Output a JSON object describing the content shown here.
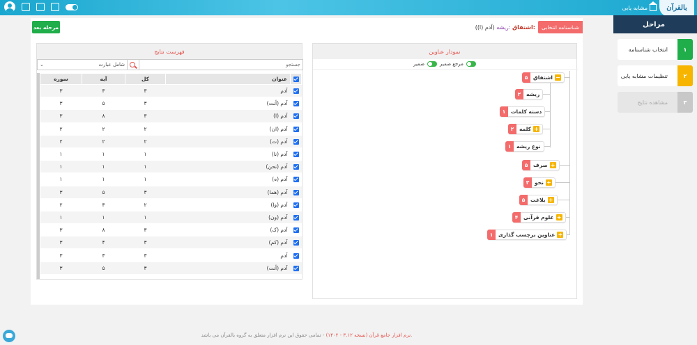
{
  "topbar": {
    "crumb": "مشابه یابی"
  },
  "steps": {
    "title": "مراحل",
    "items": [
      {
        "num": "۱",
        "label": "انتخاب شناسنامه"
      },
      {
        "num": "۲",
        "label": "تنظیمات مشابه یابی"
      },
      {
        "num": "۳",
        "label": "مشاهده نتایج"
      }
    ]
  },
  "main": {
    "next_button": "مرحله بعد",
    "chip_label": "شناسنامه انتخابی",
    "chip_key": "اشتقاق:",
    "chip_key2": "ریشه:",
    "chip_value": "(آدم (ا))"
  },
  "tree": {
    "title": "نمودار عناوین",
    "opt1": "مرجع ضمیر",
    "opt2": "ضمیر",
    "nodes": [
      {
        "label": "اشتقاق",
        "count": "۵"
      },
      {
        "label": "ریشه",
        "count": "۲"
      },
      {
        "label": "دسته کلمات",
        "count": "۱"
      },
      {
        "label": "کلمه",
        "count": "۲"
      },
      {
        "label": "نوع ریشه",
        "count": "۱"
      },
      {
        "label": "صرف",
        "count": "۵"
      },
      {
        "label": "نحو",
        "count": "۳"
      },
      {
        "label": "بلاغت",
        "count": "۵"
      },
      {
        "label": "علوم قرآنی",
        "count": "۴"
      },
      {
        "label": "عناوین برچسب گذاری",
        "count": "۱"
      }
    ]
  },
  "results": {
    "title": "فهرست نتایج",
    "search_placeholder": "جستجو",
    "filter": "شامل عبارت",
    "columns": {
      "title": "عنوان",
      "total": "کل",
      "ayah": "آیه",
      "surah": "سوره"
    },
    "rows": [
      {
        "title": "آدم",
        "total": "۳",
        "ayah": "۳",
        "surah": "۳"
      },
      {
        "title": "آدم (أنت)",
        "total": "۳",
        "ayah": "۵",
        "surah": "۳"
      },
      {
        "title": "آدم (ا)",
        "total": "۳",
        "ayah": "۸",
        "surah": "۳"
      },
      {
        "title": "آدم (ان)",
        "total": "۲",
        "ayah": "۲",
        "surah": "۲"
      },
      {
        "title": "آدم (ت)",
        "total": "۲",
        "ayah": "۲",
        "surah": "۲"
      },
      {
        "title": "آدم (نا)",
        "total": "۱",
        "ayah": "۱",
        "surah": "۱"
      },
      {
        "title": "آدم (نحن)",
        "total": "۱",
        "ayah": "۱",
        "surah": "۱"
      },
      {
        "title": "آدم (ه)",
        "total": "۱",
        "ayah": "۱",
        "surah": "۱"
      },
      {
        "title": "آدم (هما)",
        "total": "۳",
        "ayah": "۵",
        "surah": "۳"
      },
      {
        "title": "آدم (وا)",
        "total": "۲",
        "ayah": "۳",
        "surah": "۲"
      },
      {
        "title": "آدم (ون)",
        "total": "۱",
        "ayah": "۱",
        "surah": "۱"
      },
      {
        "title": "آدم (ک)",
        "total": "۳",
        "ayah": "۸",
        "surah": "۳"
      },
      {
        "title": "آدم (کم)",
        "total": "۳",
        "ayah": "۴",
        "surah": "۳"
      },
      {
        "title": "آدم",
        "total": "۳",
        "ayah": "۳",
        "surah": "۳"
      },
      {
        "title": "آدم (أنت)",
        "total": "۳",
        "ayah": "۵",
        "surah": "۳"
      }
    ]
  },
  "footer": {
    "link": "نرم افزار جامع قرآن (نسخه ۳.۱۲ - ۱۴۰۲)",
    "text": " - تمامی حقوق این نرم افزار متعلق به گروه بالقرآن می باشد."
  }
}
